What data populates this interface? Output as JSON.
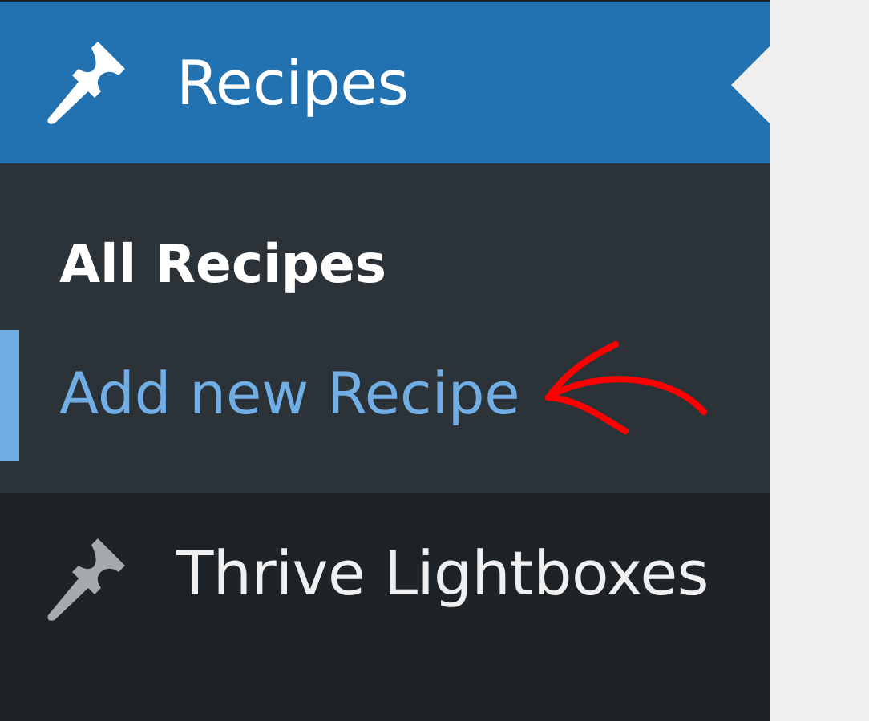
{
  "menu": [
    {
      "label": "Recipes",
      "selected": true,
      "submenu": [
        {
          "label": "All Recipes",
          "current": true,
          "focused": false
        },
        {
          "label": "Add new Recipe",
          "current": false,
          "focused": true
        }
      ]
    },
    {
      "label": "Thrive Lightboxes",
      "selected": false
    }
  ],
  "annotation": {
    "kind": "arrow",
    "color": "#ff0000"
  }
}
